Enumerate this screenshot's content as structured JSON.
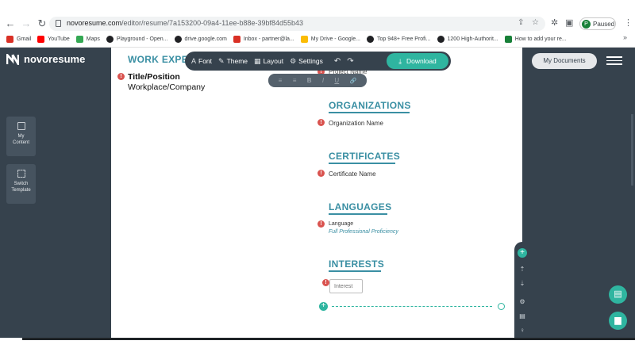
{
  "browser": {
    "url_host": "novoresume.com",
    "url_path": "/editor/resume/7a153200-09a4-11ee-b88e-39bf84d55b43",
    "profile_status": "Paused",
    "profile_initial": "P",
    "bookmarks": [
      {
        "label": "Gmail",
        "color": "#d93025"
      },
      {
        "label": "YouTube",
        "color": "#ff0000"
      },
      {
        "label": "Maps",
        "color": "#34a853"
      },
      {
        "label": "Playground - Open...",
        "color": "#202124"
      },
      {
        "label": "drive.google.com",
        "color": "#202124"
      },
      {
        "label": "Inbox - partner@la...",
        "color": "#d93025"
      },
      {
        "label": "My Drive - Google...",
        "color": "#fbbc04"
      },
      {
        "label": "Top 948+ Free Profi...",
        "color": "#202124"
      },
      {
        "label": "1200 High-Authorit...",
        "color": "#202124"
      },
      {
        "label": "How to add your re...",
        "color": "#188038"
      }
    ],
    "more": "»"
  },
  "app": {
    "logo": "novoresume",
    "rail": [
      {
        "label1": "My",
        "label2": "Content"
      },
      {
        "label1": "Switch",
        "label2": "Template"
      }
    ],
    "my_documents": "My Documents"
  },
  "toolbar": {
    "font": "Font",
    "theme": "Theme",
    "layout": "Layout",
    "settings": "Settings",
    "download": "Download",
    "format": [
      "≡",
      "≡",
      "B",
      "I",
      "U",
      "🔗"
    ]
  },
  "resume": {
    "work_heading": "WORK EXPE",
    "work_title": "Title/Position",
    "work_company": "Workplace/Company",
    "project_name_partial": "Project Name",
    "organizations_heading": "ORGANIZATIONS",
    "organization_name": "Organization Name",
    "certificates_heading": "CERTIFICATES",
    "certificate_name": "Certificate Name",
    "languages_heading": "LANGUAGES",
    "language": "Language",
    "proficiency": "Full Professional Proficiency",
    "interests_heading": "INTERESTS",
    "interest_placeholder": "Interest"
  },
  "colors": {
    "accent": "#2fb5a0",
    "heading": "#3a8fa3",
    "sidebar": "#36424d",
    "warning": "#d9534f"
  }
}
